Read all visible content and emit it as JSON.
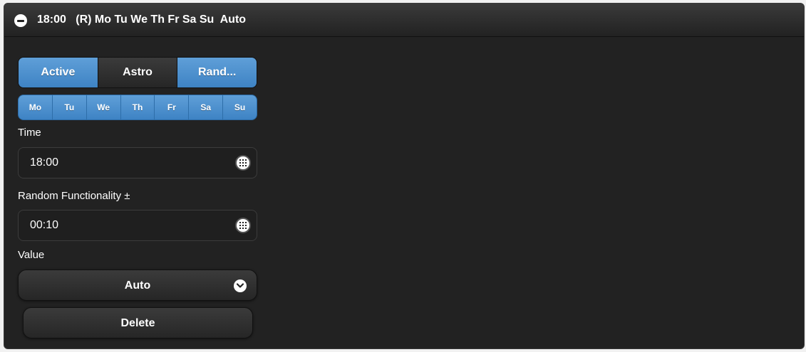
{
  "header": {
    "title": "18:00   (R) Mo Tu We Th Fr Sa Su  Auto",
    "collapse_icon": "minus-circle-icon"
  },
  "mode_buttons": [
    {
      "label": "Active",
      "selected": true
    },
    {
      "label": "Astro",
      "selected": false
    },
    {
      "label": "Rand...",
      "selected": true
    }
  ],
  "days": [
    "Mo",
    "Tu",
    "We",
    "Th",
    "Fr",
    "Sa",
    "Su"
  ],
  "time": {
    "label": "Time",
    "value": "18:00",
    "icon": "grid-icon"
  },
  "random": {
    "label": "Random Functionality ±",
    "value": "00:10",
    "icon": "grid-icon"
  },
  "value_select": {
    "label": "Value",
    "selected": "Auto",
    "icon": "chevron-down-icon"
  },
  "delete_button": {
    "label": "Delete"
  },
  "colors": {
    "panel_bg": "#222222",
    "accent_blue": "#4a8fcf",
    "text": "#ffffff"
  }
}
